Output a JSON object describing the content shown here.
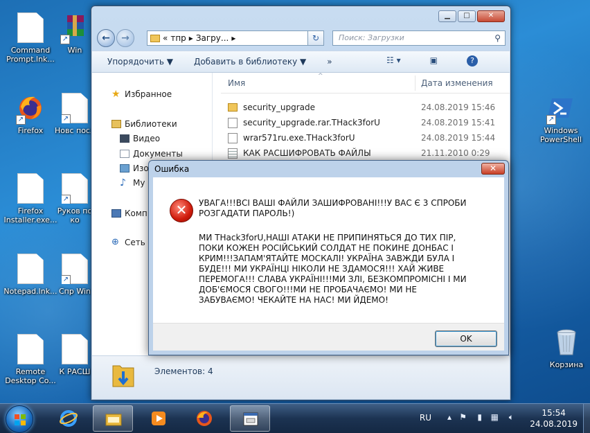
{
  "desktop": {
    "icons": [
      {
        "label": "Command Prompt.lnk...",
        "icon": "document-icon"
      },
      {
        "label": "Win",
        "icon": "winrar-icon"
      },
      {
        "label": "Firefox",
        "icon": "firefox-icon"
      },
      {
        "label": "Новс посл",
        "icon": "document-icon"
      },
      {
        "label": "Firefox Installer.exe...",
        "icon": "document-icon"
      },
      {
        "label": "Руков по ко",
        "icon": "document-icon"
      },
      {
        "label": "Notepad.lnk...",
        "icon": "document-icon"
      },
      {
        "label": "Спр Win",
        "icon": "document-icon"
      },
      {
        "label": "Remote Desktop Co...",
        "icon": "document-icon"
      },
      {
        "label": "К РАСШ",
        "icon": "document-icon"
      },
      {
        "label": "Windows PowerShell",
        "icon": "powershell-icon"
      },
      {
        "label": "Корзина",
        "icon": "recycle-bin-icon"
      }
    ]
  },
  "explorer": {
    "breadcrumb": [
      "«",
      "тпр",
      "Загру..."
    ],
    "search_placeholder": "Поиск: Загрузки",
    "toolbar": {
      "organize": "Упорядочить ▼",
      "add_library": "Добавить в библиотеку ▼",
      "more": "»"
    },
    "nav": {
      "favorites": "Избранное",
      "libraries": "Библиотеки",
      "video": "Видео",
      "documents": "Документы",
      "images": "Изо",
      "music": "Му",
      "computer": "Комп",
      "network": "Сеть"
    },
    "columns": {
      "name": "Имя",
      "date": "Дата изменения"
    },
    "files": [
      {
        "name": "security_upgrade",
        "date": "24.08.2019 15:46",
        "type": "folder"
      },
      {
        "name": "security_upgrade.rar.THack3forU",
        "date": "24.08.2019 15:41",
        "type": "file"
      },
      {
        "name": "wrar571ru.exe.THack3forU",
        "date": "24.08.2019 15:44",
        "type": "file"
      },
      {
        "name": "КАК РАСШИФРОВАТЬ ФАЙЛЫ",
        "date": "21.11.2010 0:29",
        "type": "text"
      }
    ],
    "status": "Элементов: 4"
  },
  "dialog": {
    "title": "Ошибка",
    "paragraph1": "УВАГА!!!ВСІ ВАШІ ФАЙЛИ ЗАШИФРОВАНІ!!!У ВАС Є 3 СПРОБИ РОЗГАДАТИ ПАРОЛЬ!)",
    "paragraph2": "МИ THack3forU,НАШІ АТАКИ НЕ ПРИПИНЯТЬСЯ ДО ТИХ ПІР, ПОКИ КОЖЕН РОСІЙСЬКИЙ СОЛДАТ НЕ ПОКИНЕ ДОНБАС І КРИМ!!!ЗАПАМ'ЯТАЙТЕ МОСКАЛІ! УКРАЇНА ЗАВЖДИ БУЛА І БУДЕ!!! МИ УКРАЇНЦІ НІКОЛИ НЕ ЗДАМОСЯ!!! ХАЙ ЖИВЕ ПЕРЕМОГА!!! СЛАВА УКРАЇНІ!!!МИ ЗЛІ, БЕЗКОМПРОМІСНІ І МИ ДОБ'ЄМОСЯ СВОГО!!!МИ НЕ ПРОБАЧАЄМО! МИ НЕ ЗАБУВАЄМО! ЧЕКАЙТЕ НА НАС! МИ ЙДЕМО!",
    "ok": "OK"
  },
  "taskbar": {
    "lang": "RU",
    "time": "15:54",
    "date": "24.08.2019"
  }
}
